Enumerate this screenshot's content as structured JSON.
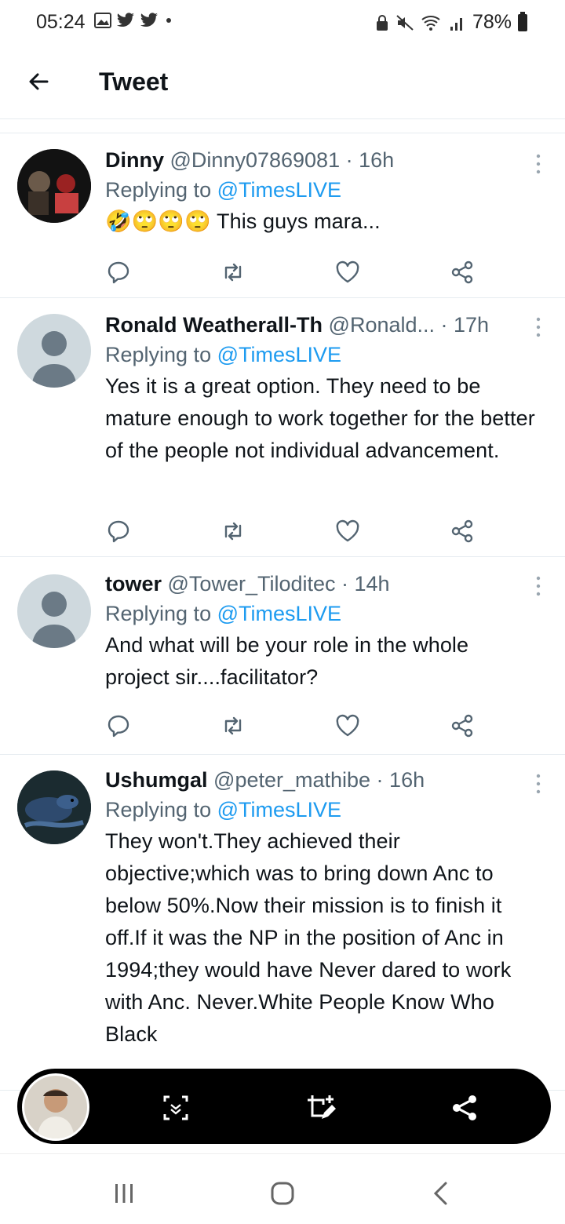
{
  "status_bar": {
    "time": "05:24",
    "battery": "78%",
    "icons": [
      "gallery-icon",
      "twitter-icon",
      "twitter-icon",
      "dot-icon",
      "lock-icon",
      "mute-icon",
      "wifi-icon",
      "signal-icon",
      "battery-icon"
    ]
  },
  "header": {
    "title": "Tweet"
  },
  "tweets": [
    {
      "name": "Dinny",
      "meta": " @Dinny07869081 · 16h",
      "replying_prefix": "Replying to ",
      "replying_to": "@TimesLIVE",
      "emoji": "🤣🙄🙄🙄",
      "text": " This guys mara..."
    },
    {
      "name": "Ronald Weatherall-Th",
      "meta": " @Ronald... · 17h",
      "replying_prefix": "Replying to ",
      "replying_to": "@TimesLIVE",
      "text": "Yes it is a great option. They need to be mature enough to work together for the better of the people not individual advancement."
    },
    {
      "name": "tower",
      "meta": " @Tower_Tiloditec · 14h",
      "replying_prefix": "Replying to ",
      "replying_to": "@TimesLIVE",
      "text": "And what will be your role in the whole project sir....facilitator?"
    },
    {
      "name": "Ushumgal",
      "meta": " @peter_mathibe · 16h",
      "replying_prefix": "Replying to ",
      "replying_to": "@TimesLIVE",
      "text": "They won't.They achieved their objective;which was to bring down Anc to below 50%.Now their mission is to finish it off.If it was the NP in the position of Anc in 1994;they would have Never dared to work with Anc. Never.White People Know Who Black"
    }
  ],
  "colors": {
    "accent": "#1d9bf0",
    "secondary_text": "#536471",
    "divider": "#e6ecf0"
  }
}
